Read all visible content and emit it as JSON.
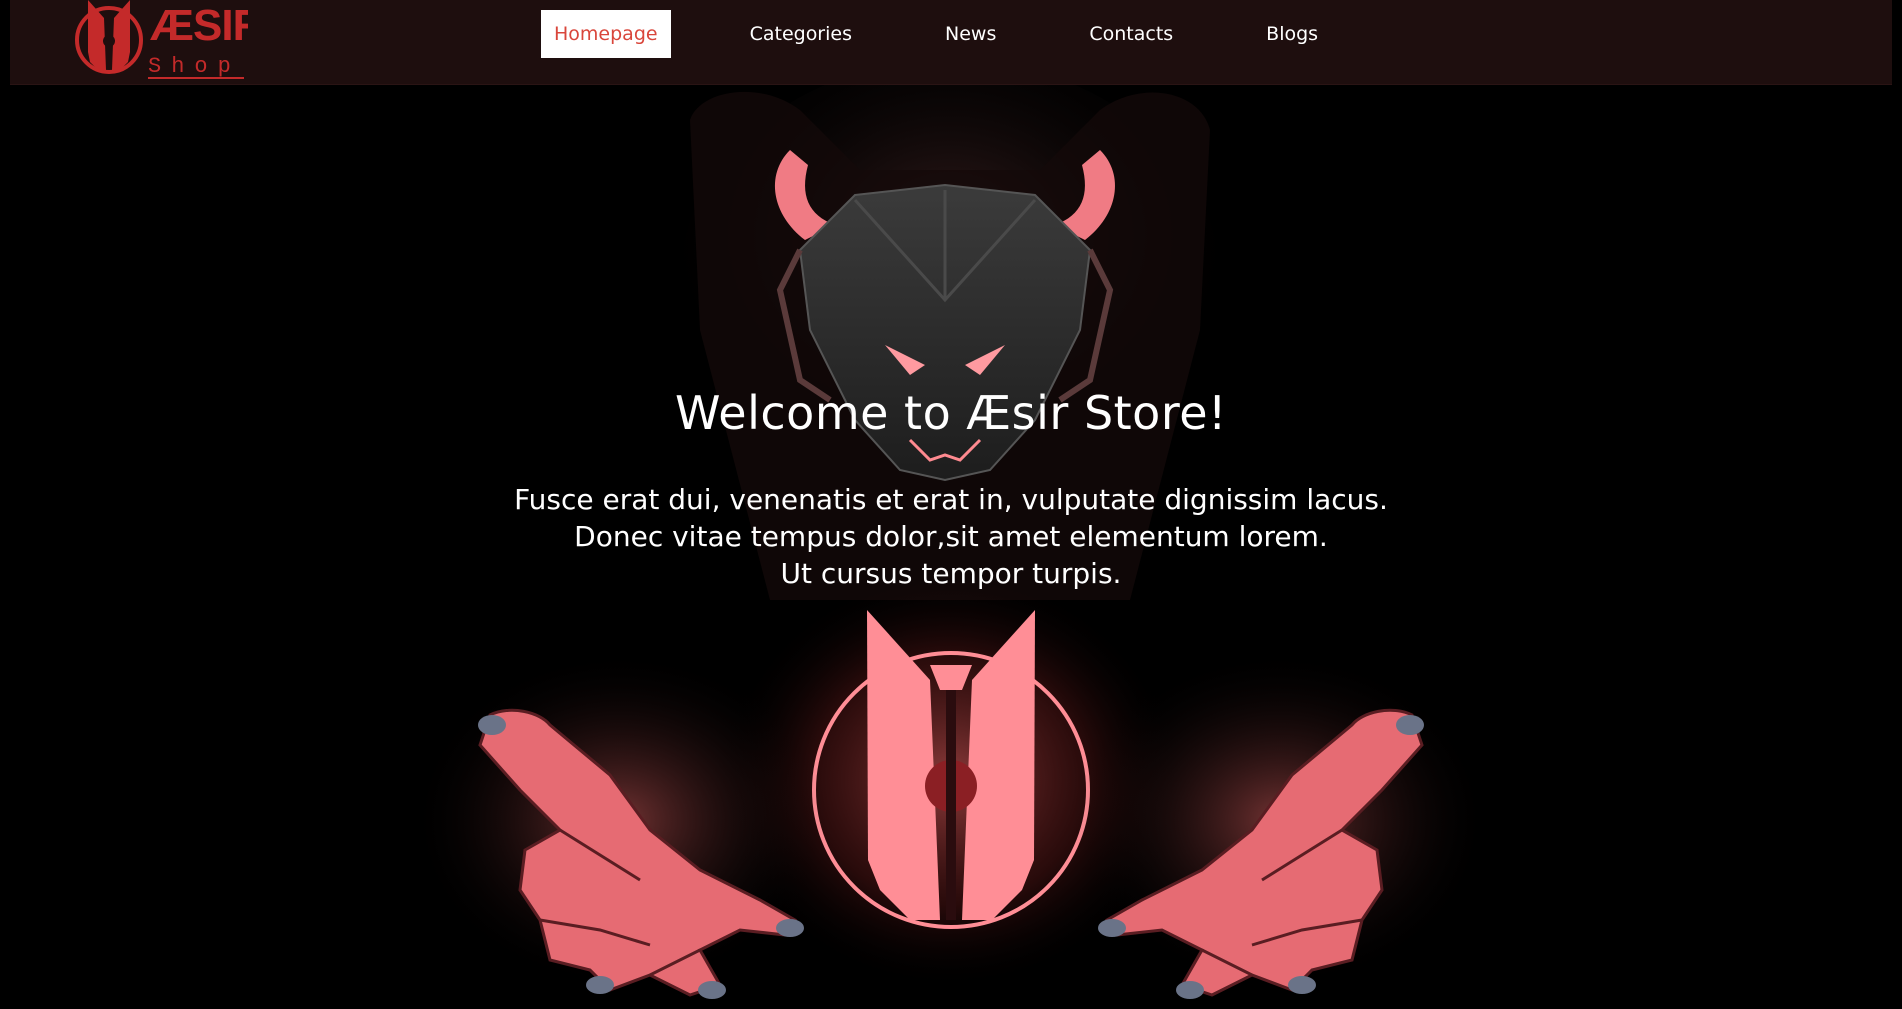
{
  "brand": {
    "logo_text": "ÆSIR",
    "logo_subtext": "Shop",
    "accent_color": "#c42a2a"
  },
  "nav": {
    "items": [
      {
        "label": "Homepage",
        "active": true
      },
      {
        "label": "Categories",
        "active": false
      },
      {
        "label": "News",
        "active": false
      },
      {
        "label": "Contacts",
        "active": false
      },
      {
        "label": "Blogs",
        "active": false
      }
    ],
    "active_color": "#d9463b",
    "bar_color": "#1e0e0e"
  },
  "hero": {
    "title": "Welcome to Æsir Store!",
    "lines": [
      "Fusce erat dui, venenatis et erat in, vulputate dignissim lacus.",
      "Donec vitae tempus dolor,sit amet elementum lorem.",
      "Ut cursus tempor turpis."
    ],
    "glow_color": "#ff8a8a"
  }
}
